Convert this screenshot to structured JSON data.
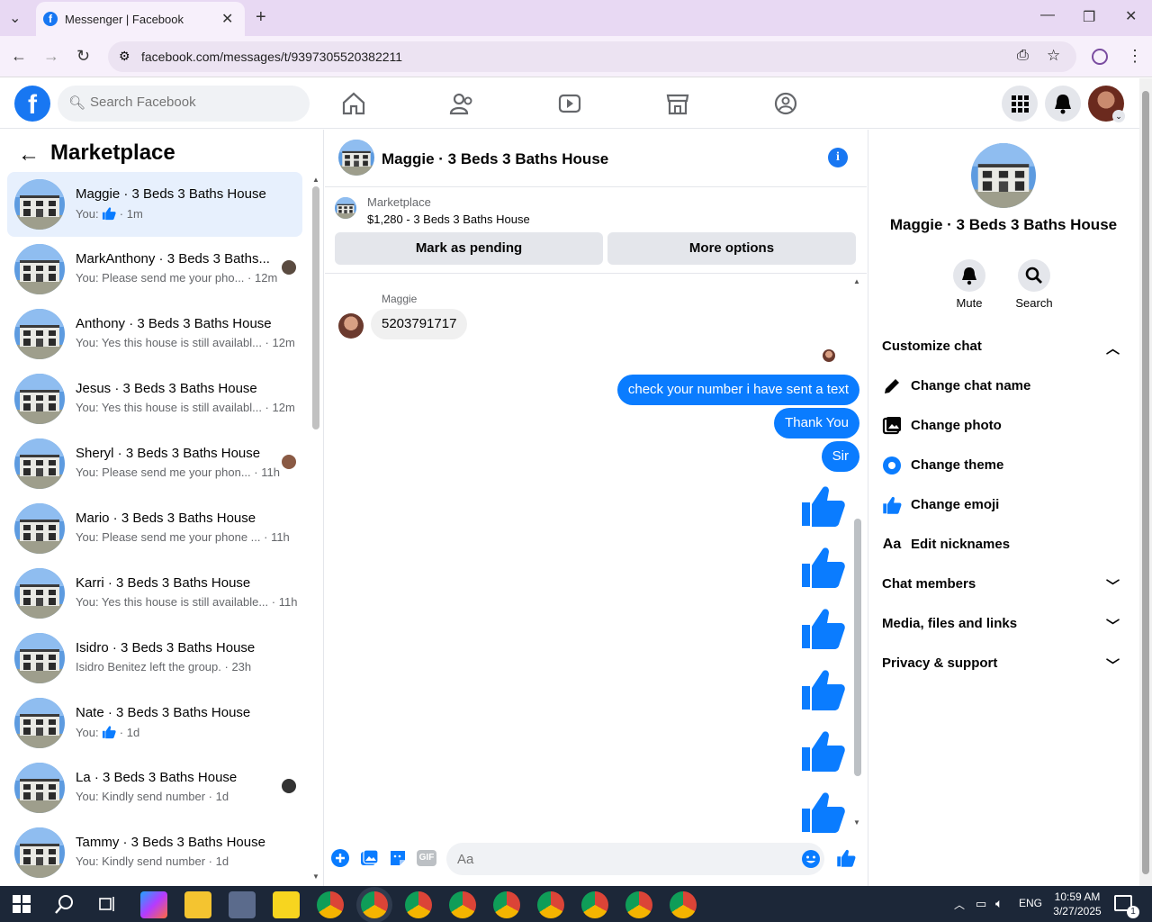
{
  "browser": {
    "tab_title": "Messenger | Facebook",
    "url": "facebook.com/messages/t/9397305520382211",
    "accent": "#e8d9f3"
  },
  "fb": {
    "search_placeholder": "Search Facebook",
    "brand_color": "#1877f2"
  },
  "left": {
    "title": "Marketplace",
    "conversations": [
      {
        "name": "Maggie · 3 Beds 3 Baths House",
        "preview": "You: ",
        "thumb": true,
        "time": "1m",
        "selected": true
      },
      {
        "name": "MarkAnthony · 3 Beds 3 Baths...",
        "preview": "You: Please send me your pho...",
        "time": "12m"
      },
      {
        "name": "Anthony · 3 Beds 3 Baths House",
        "preview": "You: Yes this house is still availabl...",
        "time": "12m"
      },
      {
        "name": "Jesus · 3 Beds 3 Baths House",
        "preview": "You: Yes this house is still availabl...",
        "time": "12m"
      },
      {
        "name": "Sheryl · 3 Beds 3 Baths House",
        "preview": "You: Please send me your phon...",
        "time": "11h"
      },
      {
        "name": "Mario · 3 Beds 3 Baths House",
        "preview": "You: Please send me your phone ...",
        "time": "11h"
      },
      {
        "name": "Karri · 3 Beds 3 Baths House",
        "preview": "You: Yes this house is still available...",
        "time": "11h"
      },
      {
        "name": "Isidro · 3 Beds 3 Baths House",
        "preview": "Isidro Benitez left the group.",
        "time": "23h"
      },
      {
        "name": "Nate · 3 Beds 3 Baths House",
        "preview": "You: ",
        "thumb": true,
        "time": "1d"
      },
      {
        "name": "La · 3 Beds 3 Baths House",
        "preview": "You: Kindly send number",
        "time": "1d"
      },
      {
        "name": "Tammy · 3 Beds 3 Baths House",
        "preview": "You: Kindly send number",
        "time": "1d"
      }
    ]
  },
  "chat": {
    "title": "Maggie · 3 Beds 3 Baths House",
    "marketplace_label": "Marketplace",
    "listing": "$1,280 - 3 Beds 3 Baths House",
    "mark_pending": "Mark as pending",
    "more_options": "More options",
    "sender": "Maggie",
    "incoming": "5203791717",
    "outgoing": [
      "check your number i have sent a text",
      "Thank You",
      "Sir"
    ],
    "input_placeholder": "Aa",
    "gif_label": "GIF",
    "bubble_color": "#0a7cff"
  },
  "right": {
    "name": "Maggie · 3 Beds 3 Baths House",
    "mute": "Mute",
    "search": "Search",
    "customize": "Customize chat",
    "options": [
      "Change chat name",
      "Change photo",
      "Change theme",
      "Change emoji",
      "Edit nicknames"
    ],
    "nick_icon": "Aa",
    "members": "Chat members",
    "media": "Media, files and links",
    "privacy": "Privacy & support"
  },
  "taskbar": {
    "lang": "ENG",
    "time": "10:59 AM",
    "date": "3/27/2025",
    "notif_count": "1"
  }
}
